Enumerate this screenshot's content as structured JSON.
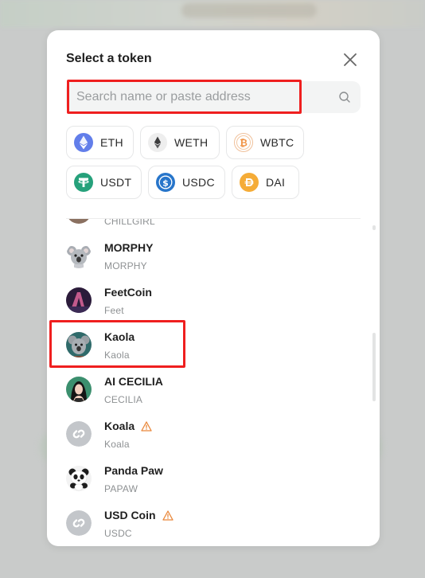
{
  "modal": {
    "title": "Select a token",
    "close_icon": "close-icon"
  },
  "search": {
    "placeholder": "Search name or paste address",
    "value": "",
    "icon": "search-icon"
  },
  "common_tokens": [
    {
      "symbol": "ETH",
      "icon": "eth-logo-icon",
      "color": "#627eea"
    },
    {
      "symbol": "WETH",
      "icon": "weth-logo-icon",
      "color": "#3c3c3d"
    },
    {
      "symbol": "WBTC",
      "icon": "wbtc-logo-icon",
      "color": "#f09242"
    },
    {
      "symbol": "USDT",
      "icon": "usdt-logo-icon",
      "color": "#26a17b"
    },
    {
      "symbol": "USDC",
      "icon": "usdc-logo-icon",
      "color": "#2775ca"
    },
    {
      "symbol": "DAI",
      "icon": "dai-logo-icon",
      "color": "#f5ac37"
    }
  ],
  "token_list": [
    {
      "name": "",
      "symbol": "CHILLGIRL",
      "icon": "chillgirl-avatar",
      "warning": false
    },
    {
      "name": "MORPHY",
      "symbol": "MORPHY",
      "icon": "koala-avatar",
      "warning": false
    },
    {
      "name": "FeetCoin",
      "symbol": "Feet",
      "icon": "feet-avatar",
      "warning": false
    },
    {
      "name": "Kaola",
      "symbol": "Kaola",
      "icon": "kaola-avatar",
      "warning": false
    },
    {
      "name": "AI CECILIA",
      "symbol": "CECILIA",
      "icon": "cecilia-avatar",
      "warning": false
    },
    {
      "name": "Koala",
      "symbol": "Koala",
      "icon": "unknown-token-icon",
      "warning": true
    },
    {
      "name": "Panda Paw",
      "symbol": "PAPAW",
      "icon": "panda-avatar",
      "warning": false
    },
    {
      "name": "USD Coin",
      "symbol": "USDC",
      "icon": "unknown-token-icon",
      "warning": true
    }
  ],
  "colors": {
    "highlight": "#ef1f1f",
    "warning": "#e9873a",
    "text_primary": "#1f1f1f",
    "text_secondary": "#8e9193"
  }
}
